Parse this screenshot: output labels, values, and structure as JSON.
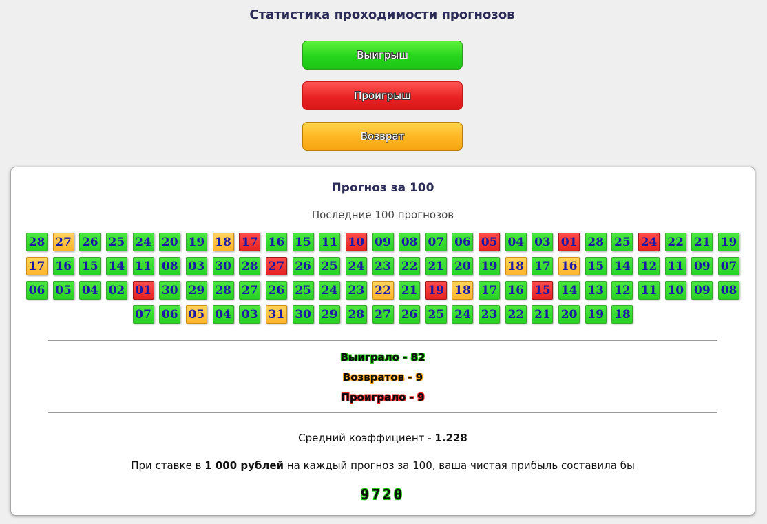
{
  "header": {
    "title": "Статистика проходимости прогнозов"
  },
  "legend": {
    "win": "Выигрыш",
    "lose": "Проигрыш",
    "return": "Возврат"
  },
  "panel": {
    "title": "Прогноз за 100",
    "subtitle": "Последние 100 прогнозов",
    "forecasts": [
      {
        "n": "28",
        "r": "win"
      },
      {
        "n": "27",
        "r": "return"
      },
      {
        "n": "26",
        "r": "win"
      },
      {
        "n": "25",
        "r": "win"
      },
      {
        "n": "24",
        "r": "win"
      },
      {
        "n": "20",
        "r": "win"
      },
      {
        "n": "19",
        "r": "win"
      },
      {
        "n": "18",
        "r": "return"
      },
      {
        "n": "17",
        "r": "lose"
      },
      {
        "n": "16",
        "r": "win"
      },
      {
        "n": "15",
        "r": "win"
      },
      {
        "n": "11",
        "r": "win"
      },
      {
        "n": "10",
        "r": "lose"
      },
      {
        "n": "09",
        "r": "win"
      },
      {
        "n": "08",
        "r": "win"
      },
      {
        "n": "07",
        "r": "win"
      },
      {
        "n": "06",
        "r": "win"
      },
      {
        "n": "05",
        "r": "lose"
      },
      {
        "n": "04",
        "r": "win"
      },
      {
        "n": "03",
        "r": "win"
      },
      {
        "n": "01",
        "r": "lose"
      },
      {
        "n": "28",
        "r": "win"
      },
      {
        "n": "25",
        "r": "win"
      },
      {
        "n": "24",
        "r": "lose"
      },
      {
        "n": "22",
        "r": "win"
      },
      {
        "n": "21",
        "r": "win"
      },
      {
        "n": "19",
        "r": "win"
      },
      {
        "n": "17",
        "r": "return"
      },
      {
        "n": "16",
        "r": "win"
      },
      {
        "n": "15",
        "r": "win"
      },
      {
        "n": "14",
        "r": "win"
      },
      {
        "n": "11",
        "r": "win"
      },
      {
        "n": "08",
        "r": "win"
      },
      {
        "n": "03",
        "r": "win"
      },
      {
        "n": "30",
        "r": "win"
      },
      {
        "n": "28",
        "r": "win"
      },
      {
        "n": "27",
        "r": "lose"
      },
      {
        "n": "26",
        "r": "win"
      },
      {
        "n": "25",
        "r": "win"
      },
      {
        "n": "24",
        "r": "win"
      },
      {
        "n": "23",
        "r": "win"
      },
      {
        "n": "22",
        "r": "win"
      },
      {
        "n": "21",
        "r": "win"
      },
      {
        "n": "20",
        "r": "win"
      },
      {
        "n": "19",
        "r": "win"
      },
      {
        "n": "18",
        "r": "return"
      },
      {
        "n": "17",
        "r": "win"
      },
      {
        "n": "16",
        "r": "return"
      },
      {
        "n": "15",
        "r": "win"
      },
      {
        "n": "14",
        "r": "win"
      },
      {
        "n": "12",
        "r": "win"
      },
      {
        "n": "11",
        "r": "win"
      },
      {
        "n": "09",
        "r": "win"
      },
      {
        "n": "07",
        "r": "win"
      },
      {
        "n": "06",
        "r": "win"
      },
      {
        "n": "05",
        "r": "win"
      },
      {
        "n": "04",
        "r": "win"
      },
      {
        "n": "02",
        "r": "win"
      },
      {
        "n": "01",
        "r": "lose"
      },
      {
        "n": "30",
        "r": "win"
      },
      {
        "n": "29",
        "r": "win"
      },
      {
        "n": "28",
        "r": "win"
      },
      {
        "n": "27",
        "r": "win"
      },
      {
        "n": "26",
        "r": "win"
      },
      {
        "n": "25",
        "r": "win"
      },
      {
        "n": "24",
        "r": "win"
      },
      {
        "n": "23",
        "r": "win"
      },
      {
        "n": "22",
        "r": "return"
      },
      {
        "n": "21",
        "r": "win"
      },
      {
        "n": "19",
        "r": "lose"
      },
      {
        "n": "18",
        "r": "return"
      },
      {
        "n": "17",
        "r": "win"
      },
      {
        "n": "16",
        "r": "win"
      },
      {
        "n": "15",
        "r": "lose"
      },
      {
        "n": "14",
        "r": "win"
      },
      {
        "n": "13",
        "r": "win"
      },
      {
        "n": "12",
        "r": "win"
      },
      {
        "n": "11",
        "r": "win"
      },
      {
        "n": "10",
        "r": "win"
      },
      {
        "n": "09",
        "r": "win"
      },
      {
        "n": "08",
        "r": "win"
      },
      {
        "n": "07",
        "r": "win"
      },
      {
        "n": "06",
        "r": "win"
      },
      {
        "n": "05",
        "r": "return"
      },
      {
        "n": "04",
        "r": "win"
      },
      {
        "n": "03",
        "r": "win"
      },
      {
        "n": "31",
        "r": "return"
      },
      {
        "n": "30",
        "r": "win"
      },
      {
        "n": "29",
        "r": "win"
      },
      {
        "n": "28",
        "r": "win"
      },
      {
        "n": "27",
        "r": "win"
      },
      {
        "n": "26",
        "r": "win"
      },
      {
        "n": "25",
        "r": "win"
      },
      {
        "n": "24",
        "r": "win"
      },
      {
        "n": "23",
        "r": "win"
      },
      {
        "n": "22",
        "r": "win"
      },
      {
        "n": "21",
        "r": "win"
      },
      {
        "n": "20",
        "r": "win"
      },
      {
        "n": "19",
        "r": "win"
      },
      {
        "n": "18",
        "r": "win"
      }
    ],
    "stats": {
      "won": "Выиграло - 82",
      "returns": "Возвратов - 9",
      "lost": "Проиграло - 9"
    },
    "avg_label": "Средний коэффициент - ",
    "avg_value": "1.228",
    "profit_prefix": "При ставке в ",
    "profit_stake": "1 000 рублей",
    "profit_suffix": " на каждый прогноз за 100, ваша чистая прибыль составила бы",
    "profit_value": "9720"
  },
  "colors": {
    "win": "#28d124",
    "lose": "#e52222",
    "return": "#ffb52b",
    "number": "#1a1aa6"
  }
}
